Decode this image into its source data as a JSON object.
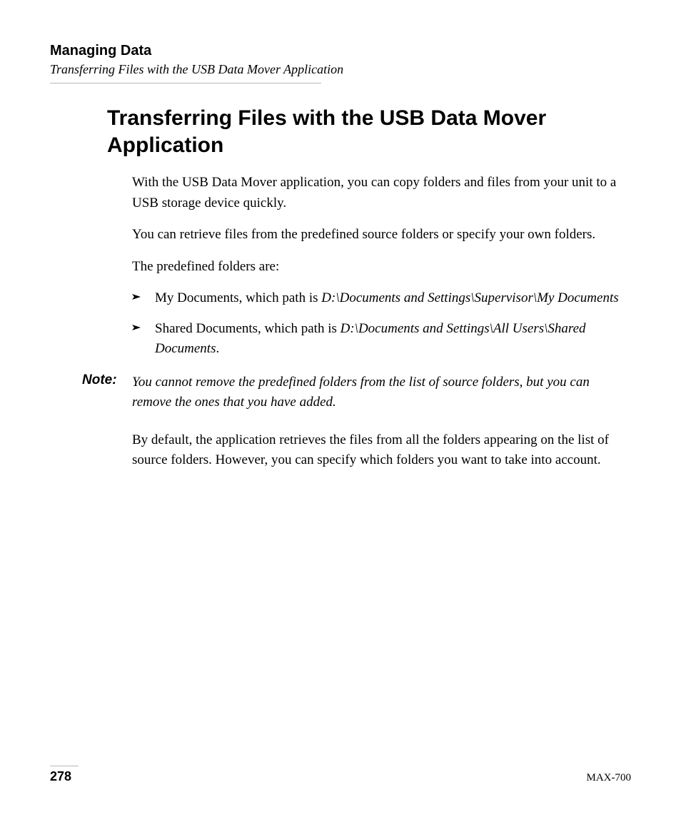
{
  "header": {
    "chapter": "Managing Data",
    "section": "Transferring Files with the USB Data Mover Application"
  },
  "heading": "Transferring Files with the USB Data Mover Application",
  "paragraphs": {
    "intro1": "With the USB Data Mover application, you can copy folders and files from your unit to a USB storage device quickly.",
    "intro2": "You can retrieve files from the predefined source folders or specify your own folders.",
    "intro3": "The predefined folders are:",
    "after_note": "By default, the application retrieves the files from all the folders appearing on the list of source folders. However, you can specify which folders you want to take into account."
  },
  "bullets": [
    {
      "lead": "My Documents, which path is ",
      "path": "D:\\Documents and Settings\\Supervisor\\My Documents"
    },
    {
      "lead": "Shared Documents, which path is ",
      "path": "D:\\Documents and Settings\\All Users\\Shared Documents",
      "tail": "."
    }
  ],
  "note": {
    "label": "Note:",
    "text": "You cannot remove the predefined folders from the list of source folders, but you can remove the ones that you have added."
  },
  "footer": {
    "page": "278",
    "model": "MAX-700"
  }
}
